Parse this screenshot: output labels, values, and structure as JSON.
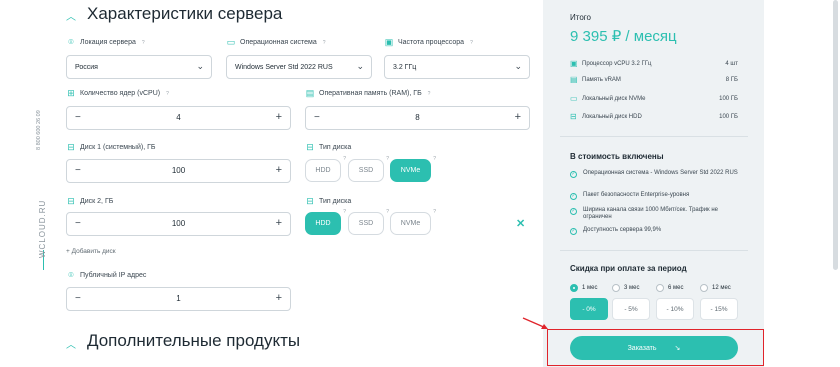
{
  "side": {
    "phone": "8 800 600 26 09",
    "logo": "WCLOUD.RU"
  },
  "server": {
    "title": "Характеристики сервера",
    "location": {
      "label": "Локация сервера",
      "value": "Россия"
    },
    "os": {
      "label": "Операционная система",
      "value": "Windows Server Std 2022 RUS"
    },
    "cpu_freq": {
      "label": "Частота процессора",
      "value": "3.2 ГГц"
    },
    "cores": {
      "label": "Количество ядер (vCPU)",
      "value": "4"
    },
    "ram": {
      "label": "Оперативная память (RAM), ГБ",
      "value": "8"
    },
    "disk1": {
      "label": "Диск 1 (системный), ГБ",
      "value": "100",
      "type_label": "Тип диска",
      "types": [
        "HDD",
        "SSD",
        "NVMe"
      ],
      "selected": "NVMe"
    },
    "disk2": {
      "label": "Диск 2, ГБ",
      "value": "100",
      "type_label": "Тип диска",
      "types": [
        "HDD",
        "SSD",
        "NVMe"
      ],
      "selected": "HDD"
    },
    "add_disk": "+ Добавить диск",
    "ip": {
      "label": "Публичный IP адрес",
      "value": "1"
    }
  },
  "extra": {
    "title": "Дополнительные продукты"
  },
  "summary": {
    "title": "Итого",
    "price": "9 395 ₽ / месяц",
    "specs": [
      {
        "label": "Процессор vCPU 3.2 ГГц",
        "value": "4 шт"
      },
      {
        "label": "Память vRAM",
        "value": "8 ГБ"
      },
      {
        "label": "Локальный диск NVMe",
        "value": "100 ГБ"
      },
      {
        "label": "Локальный диск HDD",
        "value": "100 ГБ"
      }
    ],
    "included_title": "В стоимость включены",
    "included": [
      "Операционная система - Windows Server Std 2022 RUS",
      "Пакет безопасности Enterprise-уровня",
      "Ширина канала связи 1000 Мбит/сек. Трафик не ограничен",
      "Доступность сервера 99,9%"
    ],
    "discount_title": "Скидка при оплате за период",
    "periods": [
      "1 мес",
      "3 мес",
      "6 мес",
      "12 мес"
    ],
    "selected_period": "1 мес",
    "discounts": [
      "- 0%",
      "- 5%",
      "- 10%",
      "- 15%"
    ],
    "order_label": "Заказать",
    "order_arrow": "↘"
  },
  "colors": {
    "accent": "#2cbfb0",
    "highlight": "#e0242b"
  }
}
